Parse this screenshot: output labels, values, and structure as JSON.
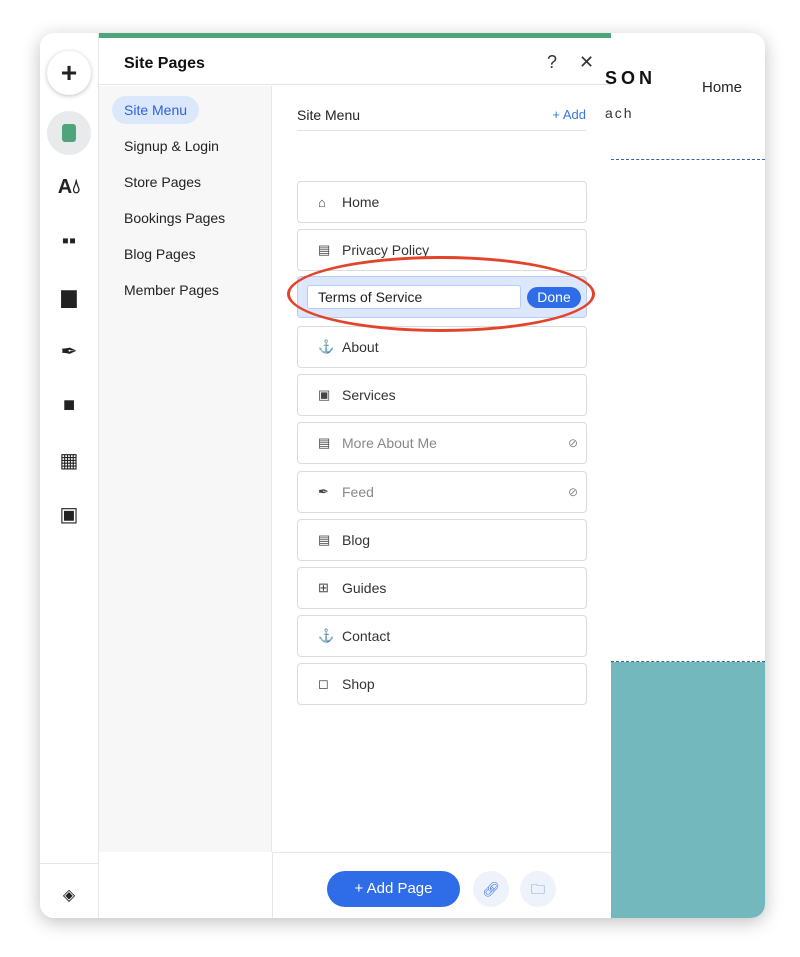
{
  "rail": {
    "icons": [
      "plus-icon",
      "pages-icon",
      "theme-icon",
      "apps-icon",
      "media-icon",
      "pen-icon",
      "store-bag-icon",
      "calendar-icon",
      "portfolio-icon",
      "layers-icon"
    ]
  },
  "panel": {
    "title": "Site Pages",
    "help": "?",
    "close": "✕"
  },
  "nav": {
    "items": [
      "Site Menu",
      "Signup & Login",
      "Store Pages",
      "Bookings Pages",
      "Blog Pages",
      "Member Pages"
    ]
  },
  "main": {
    "header": "Site Menu",
    "add_label": "+ Add",
    "edit": {
      "value": "Terms of Service",
      "done": "Done"
    },
    "pages": [
      {
        "label": "Home",
        "icon": "home-icon",
        "glyph": "⌂"
      },
      {
        "label": "Privacy Policy",
        "icon": "page-icon",
        "glyph": "▤"
      },
      {
        "label": "About",
        "icon": "anchor-icon",
        "glyph": "⚓"
      },
      {
        "label": "Services",
        "icon": "bookings-icon",
        "glyph": "▣"
      },
      {
        "label": "More About Me",
        "icon": "page-icon",
        "glyph": "▤",
        "hidden": true
      },
      {
        "label": "Feed",
        "icon": "pen-icon",
        "glyph": "✒",
        "hidden": true
      },
      {
        "label": "Blog",
        "icon": "page-icon",
        "glyph": "▤"
      },
      {
        "label": "Guides",
        "icon": "apps-icon",
        "glyph": "⊞"
      },
      {
        "label": "Contact",
        "icon": "anchor-icon",
        "glyph": "⚓"
      },
      {
        "label": "Shop",
        "icon": "bag-icon",
        "glyph": "◻"
      }
    ]
  },
  "footer": {
    "add_page": "+ Add Page"
  },
  "preview": {
    "logo": "SON",
    "sub": "ach",
    "nav_home": "Home"
  },
  "colors": {
    "accent": "#2f6de8",
    "green": "#4fa57b",
    "teal": "#72b8bc",
    "annotation": "#e2432a"
  }
}
